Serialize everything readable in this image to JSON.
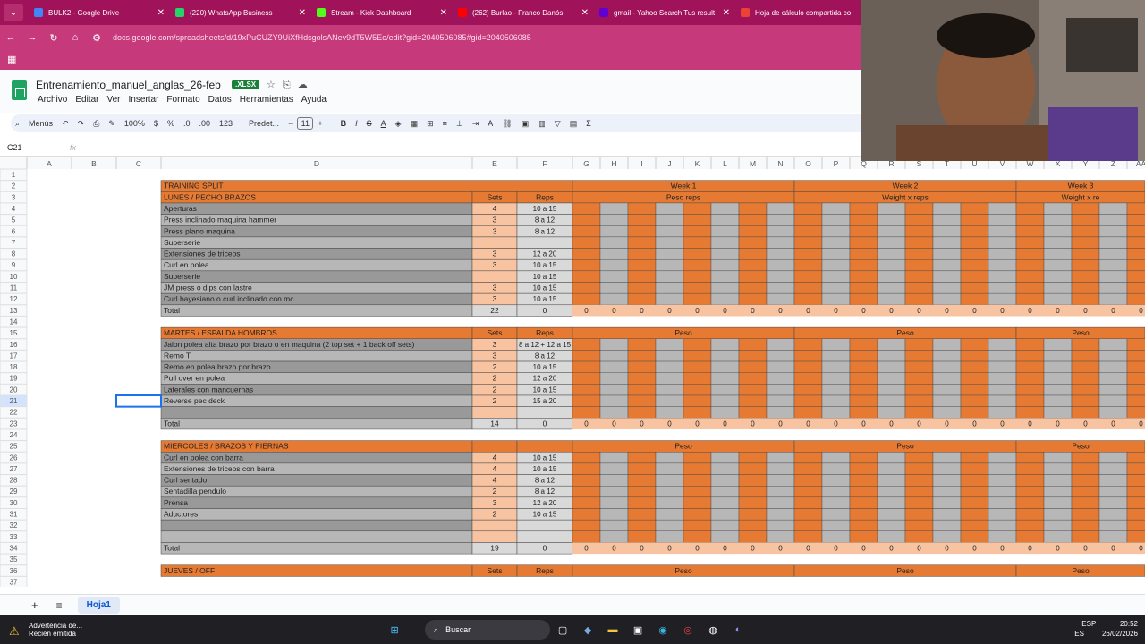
{
  "browser": {
    "tabs": [
      {
        "title": "BULK2 - Google Drive",
        "color": "#4285f4"
      },
      {
        "title": "(220) WhatsApp Business",
        "color": "#25d366"
      },
      {
        "title": "Stream - Kick Dashboard",
        "color": "#53fc18"
      },
      {
        "title": "(262) Burlao - Franco Danós",
        "color": "#ff0000"
      },
      {
        "title": "gmail - Yahoo Search Tus result",
        "color": "#6001d2"
      },
      {
        "title": "Hoja de cálculo compartida co",
        "color": "#ea4335"
      }
    ],
    "url": "docs.google.com/spreadsheets/d/19xPuCUZY9UiXfHdsgolsANev9dT5W5Eo/edit?gid=2040506085#gid=2040506085"
  },
  "doc": {
    "title": "Entrenamiento_manuel_anglas_26-feb",
    "badge": ".XLSX",
    "menus": [
      "Archivo",
      "Editar",
      "Ver",
      "Insertar",
      "Formato",
      "Datos",
      "Herramientas",
      "Ayuda"
    ]
  },
  "toolbar": {
    "menus": "Menús",
    "zoom": "100%",
    "currency": "$",
    "percent": "%",
    "dec_down": ".0",
    "dec_up": ".00",
    "numfmt": "123",
    "font": "Predet...",
    "size": "11"
  },
  "formula": {
    "cell": "C21",
    "fx": "fx"
  },
  "columns": [
    "A",
    "B",
    "C",
    "D",
    "E",
    "F",
    "G",
    "H",
    "I",
    "J",
    "K",
    "L",
    "M",
    "N",
    "O",
    "P",
    "Q",
    "R",
    "S",
    "T",
    "U",
    "V",
    "W",
    "X",
    "Y",
    "Z",
    "AA"
  ],
  "sheet": {
    "title": "TRAINING SPLIT",
    "weeks": [
      "Week 1",
      "Week 2",
      "Week 3"
    ],
    "sections": [
      {
        "header": "LUNES / PECHO BRAZOS",
        "sets_label": "Sets",
        "reps_label": "Reps",
        "week_sub": [
          "Peso reps",
          "Weight x reps",
          "Weight x re"
        ],
        "rows": [
          [
            "Aperturas",
            "4",
            "10 a 15"
          ],
          [
            "Press inclinado maquina hammer",
            "3",
            "8 a 12"
          ],
          [
            "Press plano maquina",
            "3",
            "8 a 12"
          ],
          [
            "Superserie",
            "",
            ""
          ],
          [
            "Extensiones de triceps",
            "3",
            "12 a 20"
          ],
          [
            "Curl en polea",
            "3",
            "10 a 15"
          ],
          [
            "Superserie",
            "",
            "10 a 15"
          ],
          [
            "JM press o dips con lastre",
            "3",
            "10 a 15"
          ],
          [
            "Curl bayesiano o curl inclinado con mc",
            "3",
            "10 a 15"
          ]
        ],
        "total": [
          "Total",
          "22",
          "0"
        ],
        "zeros": "0"
      },
      {
        "header": "MARTES / ESPALDA HOMBROS",
        "sets_label": "Sets",
        "reps_label": "Reps",
        "week_sub": [
          "Peso",
          "Peso",
          "Peso"
        ],
        "rows": [
          [
            "Jalon polea alta brazo por brazo o en maquina (2 top set + 1 back off sets)",
            "3",
            "8 a 12 + 12 a 15"
          ],
          [
            "Remo T",
            "3",
            "8 a 12"
          ],
          [
            "Remo en polea brazo por brazo",
            "2",
            "10 a 15"
          ],
          [
            "Pull over en polea",
            "2",
            "12 a 20"
          ],
          [
            "Laterales con mancuernas",
            "2",
            "10 a 15"
          ],
          [
            "Reverse pec deck",
            "2",
            "15 a 20"
          ]
        ],
        "total": [
          "Total",
          "14",
          "0"
        ],
        "zeros": "0"
      },
      {
        "header": "MIERCOLES / BRAZOS Y PIERNAS",
        "sets_label": "",
        "reps_label": "",
        "week_sub": [
          "Peso",
          "Peso",
          "Peso"
        ],
        "rows": [
          [
            "Curl en polea con barra",
            "4",
            "10 a 15"
          ],
          [
            "Extensiones de triceps con barra",
            "4",
            "10 a 15"
          ],
          [
            "Curl sentado",
            "4",
            "8 a 12"
          ],
          [
            "Sentadilla pendulo",
            "2",
            "8 a 12"
          ],
          [
            "Prensa",
            "3",
            "12 a 20"
          ],
          [
            "Aductores",
            "2",
            "10 a 15"
          ]
        ],
        "total": [
          "Total",
          "19",
          "0"
        ],
        "zeros": "0"
      },
      {
        "header": "JUEVES / OFF",
        "sets_label": "Sets",
        "reps_label": "Reps",
        "week_sub": [
          "Peso",
          "Peso",
          "Peso"
        ],
        "rows": [],
        "total": null
      }
    ]
  },
  "bottom": {
    "sheet_tab": "Hoja1"
  },
  "taskbar": {
    "warning_title": "Advertencia de...",
    "warning_sub": "Recién emitida",
    "search": "Buscar",
    "lang": "ESP",
    "lang2": "ES",
    "time": "20:52",
    "date": "26/02/2026"
  },
  "colors": {
    "orange": "#e67a32",
    "light_orange": "#f8c3a0",
    "grey": "#b7b7b7",
    "dark_grey": "#999999",
    "section_header": "#e67a32"
  }
}
